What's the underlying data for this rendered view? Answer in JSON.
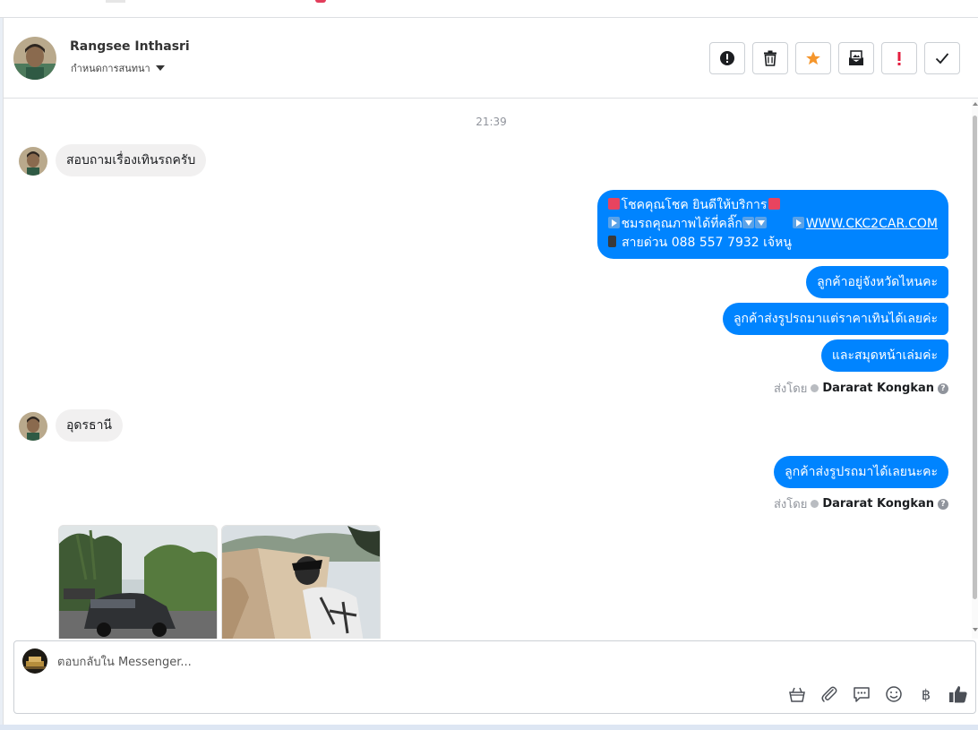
{
  "header": {
    "name": "Rangsee Inthasri",
    "status": "กำหนดการสนทนา"
  },
  "actions": [
    {
      "name": "alert-button",
      "icon": "alert-circle-icon"
    },
    {
      "name": "delete-button",
      "icon": "trash-icon"
    },
    {
      "name": "star-button",
      "icon": "star-icon"
    },
    {
      "name": "mark-unread-button",
      "icon": "envelope-image-icon"
    },
    {
      "name": "spam-button",
      "icon": "exclamation-icon"
    },
    {
      "name": "done-button",
      "icon": "check-icon"
    }
  ],
  "colors": {
    "accent": "#0084ff",
    "star": "#f5962c",
    "spam": "#e41e3f"
  },
  "conversation": {
    "timestamp": "21:39",
    "msg1": "สอบถามเรื่องเทินรถครับ",
    "welcome_line1": "โชคคุณโชค ยินดีให้บริการ",
    "welcome_line2": "ชมรถคุณภาพได้ที่คลิ๊ก",
    "welcome_link": "WWW.CKC2CAR.COM",
    "welcome_line3": "สายด่วน 088 557 7932 เจ้หนู",
    "reply1": "ลูกค้าอยู่จังหวัดไหนคะ",
    "reply2": "ลูกค้าส่งรูปรถมาแต่ราคาเทินได้เลยค่ะ",
    "reply3": "และสมุดหน้าเล่มค่ะ",
    "sent_by_label": "ส่งโดย",
    "sent_by_name": "Dararat Kongkan",
    "msg2": "อุดรธานี",
    "reply4": "ลูกค้าส่งรูปรถมาได้เลยนะคะ"
  },
  "composer": {
    "placeholder": "ตอบกลับใน Messenger..."
  }
}
